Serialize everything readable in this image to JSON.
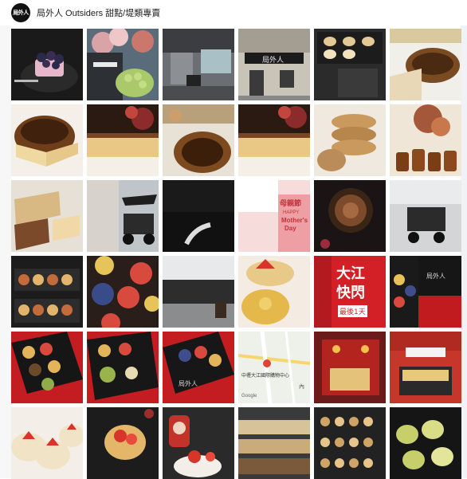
{
  "header": {
    "avatar_text": "局外人",
    "page_title": "局外人 Outsiders 甜點/堤類專賣"
  },
  "tiles": [
    {
      "name": "photo-berry-cake"
    },
    {
      "name": "photo-shop-flowers-green-cake"
    },
    {
      "name": "photo-cafe-interior"
    },
    {
      "name": "photo-shop-storefront",
      "sign": "局外人"
    },
    {
      "name": "photo-tart-boxes"
    },
    {
      "name": "photo-basque-cheesecake-top"
    },
    {
      "name": "photo-basque-cheesecake-slice"
    },
    {
      "name": "photo-cheesecake-with-flowers"
    },
    {
      "name": "photo-cheesecake-top-view"
    },
    {
      "name": "photo-cheesecake-flowers-2"
    },
    {
      "name": "photo-cookies-stack"
    },
    {
      "name": "photo-canele-pastries"
    },
    {
      "name": "photo-layered-cake-slices"
    },
    {
      "name": "photo-cart-building"
    },
    {
      "name": "photo-dark-ring"
    },
    {
      "name": "photo-mothers-day-card",
      "line1": "母親節",
      "line2": "HAPPY",
      "line3": "Mother's",
      "line4": "Day"
    },
    {
      "name": "photo-chocolate-rose-tart"
    },
    {
      "name": "photo-cart-mall"
    },
    {
      "name": "photo-tarts-box-display"
    },
    {
      "name": "photo-fruit-tarts-top"
    },
    {
      "name": "photo-shop-front-street"
    },
    {
      "name": "photo-strawberry-tart-slice"
    },
    {
      "name": "photo-popup-event-sign",
      "line1": "大江",
      "line2": "快閃",
      "line3": "最後1天"
    },
    {
      "name": "photo-tarts-red-box",
      "box_label": "局外人"
    },
    {
      "name": "photo-tart-box-assortment"
    },
    {
      "name": "photo-tart-box-matcha"
    },
    {
      "name": "photo-tart-box-blueberry",
      "box_label": "局外人"
    },
    {
      "name": "photo-mall-map",
      "label1": "中壢大江國際購物中心",
      "label2": "Google",
      "label3": "內"
    },
    {
      "name": "photo-popup-shop-red"
    },
    {
      "name": "photo-shop-counter"
    },
    {
      "name": "photo-strawberry-tarts"
    },
    {
      "name": "photo-strawberry-tart-dark"
    },
    {
      "name": "photo-santa-cake"
    },
    {
      "name": "photo-display-case"
    },
    {
      "name": "photo-tarts-display-shelves"
    },
    {
      "name": "photo-domed-tarts"
    }
  ]
}
